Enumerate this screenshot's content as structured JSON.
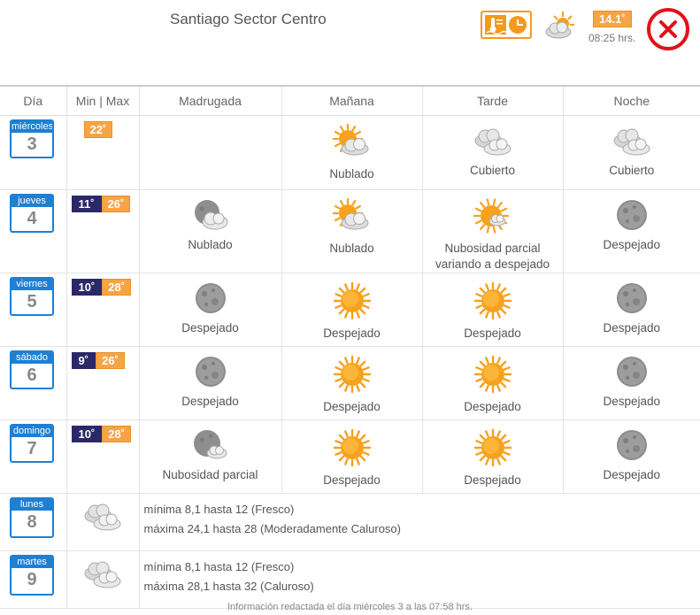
{
  "header": {
    "title": "Santiago Sector Centro",
    "current_temp": "14.1˚",
    "current_time": "08:25 hrs."
  },
  "columns": [
    "Día",
    "Min | Max",
    "Madrugada",
    "Mañana",
    "Tarde",
    "Noche"
  ],
  "days": [
    {
      "day": "miércoles",
      "num": "3",
      "min": "",
      "max": "22˚",
      "madrugada": {
        "icon": "",
        "label": ""
      },
      "manana": {
        "icon": "sun-cloud-icon",
        "label": "Nublado"
      },
      "tarde": {
        "icon": "cloudy-icon",
        "label": "Cubierto"
      },
      "noche": {
        "icon": "cloudy-icon",
        "label": "Cubierto"
      }
    },
    {
      "day": "jueves",
      "num": "4",
      "min": "11˚",
      "max": "26˚",
      "madrugada": {
        "icon": "moon-cloud-icon",
        "label": "Nublado"
      },
      "manana": {
        "icon": "sun-cloud-icon",
        "label": "Nublado"
      },
      "tarde": {
        "icon": "sun-small-cloud-icon",
        "label": "Nubosidad parcial variando a despejado"
      },
      "noche": {
        "icon": "moon-icon",
        "label": "Despejado"
      }
    },
    {
      "day": "viernes",
      "num": "5",
      "min": "10˚",
      "max": "28˚",
      "madrugada": {
        "icon": "moon-icon",
        "label": "Despejado"
      },
      "manana": {
        "icon": "sun-icon",
        "label": "Despejado"
      },
      "tarde": {
        "icon": "sun-icon",
        "label": "Despejado"
      },
      "noche": {
        "icon": "moon-icon",
        "label": "Despejado"
      }
    },
    {
      "day": "sábado",
      "num": "6",
      "min": "9˚",
      "max": "26˚",
      "madrugada": {
        "icon": "moon-icon",
        "label": "Despejado"
      },
      "manana": {
        "icon": "sun-icon",
        "label": "Despejado"
      },
      "tarde": {
        "icon": "sun-icon",
        "label": "Despejado"
      },
      "noche": {
        "icon": "moon-icon",
        "label": "Despejado"
      }
    },
    {
      "day": "domingo",
      "num": "7",
      "min": "10˚",
      "max": "28˚",
      "madrugada": {
        "icon": "moon-small-cloud-icon",
        "label": "Nubosidad parcial"
      },
      "manana": {
        "icon": "sun-icon",
        "label": "Despejado"
      },
      "tarde": {
        "icon": "sun-icon",
        "label": "Despejado"
      },
      "noche": {
        "icon": "moon-icon",
        "label": "Despejado"
      }
    }
  ],
  "summaries": [
    {
      "day": "lunes",
      "num": "8",
      "icon": "cloudy-icon",
      "line1": "mínima 8,1 hasta 12 (Fresco)",
      "line2": "máxima 24,1 hasta 28 (Moderadamente Caluroso)"
    },
    {
      "day": "martes",
      "num": "9",
      "icon": "cloudy-icon",
      "line1": "mínima 8,1 hasta 12 (Fresco)",
      "line2": "máxima 28,1 hasta 32 (Caluroso)"
    }
  ],
  "footer": "Información redactada el día miércoles 3 a las 07:58 hrs.",
  "colors": {
    "accent_blue": "#1e7fd3",
    "min_bg": "#2b2869",
    "max_bg": "#f7a446",
    "close_red": "#e2121b"
  }
}
